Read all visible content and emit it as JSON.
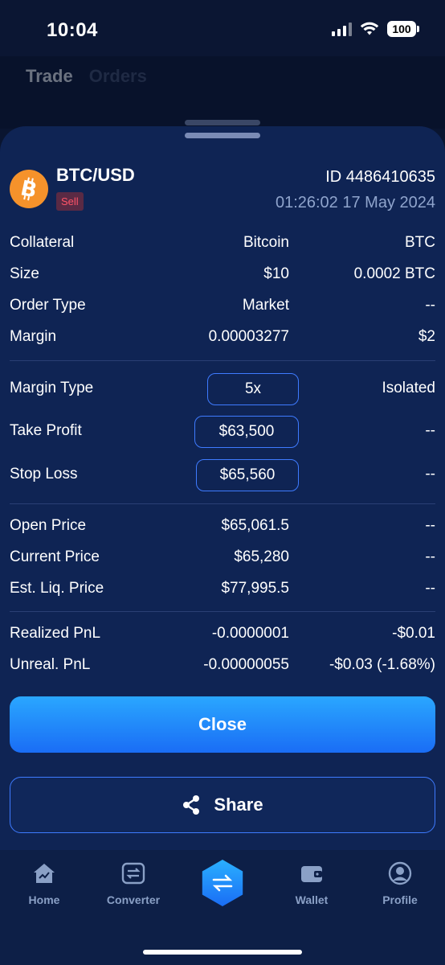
{
  "status_bar": {
    "time": "10:04",
    "battery": "100"
  },
  "background_tabs": {
    "trade": "Trade",
    "orders": "Orders"
  },
  "order": {
    "pair": "BTC/USD",
    "side": "Sell",
    "id": "ID 4486410635",
    "datetime": "01:26:02 17 May 2024"
  },
  "details": {
    "collateral": {
      "label": "Collateral",
      "mid": "Bitcoin",
      "right": "BTC"
    },
    "size": {
      "label": "Size",
      "mid": "$10",
      "right": "0.0002 BTC"
    },
    "order_type": {
      "label": "Order Type",
      "mid": "Market",
      "right": "--"
    },
    "margin": {
      "label": "Margin",
      "mid": "0.00003277",
      "right": "$2"
    }
  },
  "settings": {
    "margin_type": {
      "label": "Margin Type",
      "value": "5x",
      "right": "Isolated"
    },
    "take_profit": {
      "label": "Take Profit",
      "value": "$63,500",
      "right": "--"
    },
    "stop_loss": {
      "label": "Stop Loss",
      "value": "$65,560",
      "right": "--"
    }
  },
  "prices": {
    "open_price": {
      "label": "Open Price",
      "mid": "$65,061.5",
      "right": "--"
    },
    "current_price": {
      "label": "Current Price",
      "mid": "$65,280",
      "right": "--"
    },
    "est_liq_price": {
      "label": "Est. Liq. Price",
      "mid": "$77,995.5",
      "right": "--"
    }
  },
  "pnl": {
    "realized": {
      "label": "Realized PnL",
      "mid": "-0.0000001",
      "right": "-$0.01"
    },
    "unrealized": {
      "label": "Unreal. PnL",
      "mid": "-0.00000055",
      "right": "-$0.03 (-1.68%)"
    }
  },
  "actions": {
    "close": "Close",
    "share": "Share"
  },
  "tabbar": {
    "home": "Home",
    "converter": "Converter",
    "wallet": "Wallet",
    "profile": "Profile"
  },
  "colors": {
    "accent": "#1a6df5",
    "sheet_bg": "#0f2454",
    "sell": "#ff5468",
    "btc": "#f5922b"
  }
}
